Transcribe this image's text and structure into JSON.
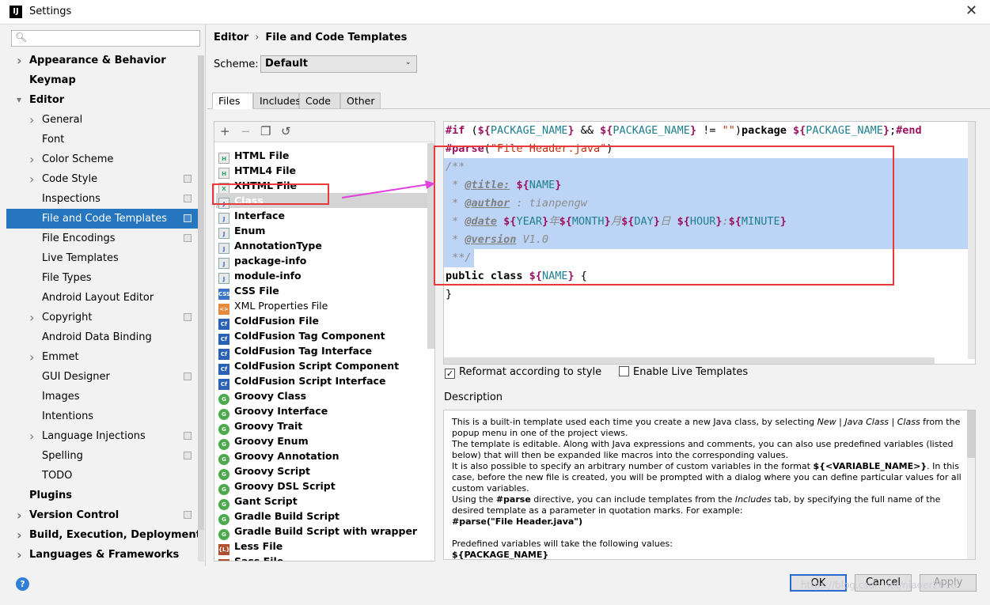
{
  "window": {
    "title": "Settings",
    "close_icon": "close-icon"
  },
  "search": {
    "placeholder": "Q↓"
  },
  "sidebar": {
    "items": [
      {
        "label": "Appearance & Behavior",
        "bold": true,
        "arrow": true,
        "indent": 0
      },
      {
        "label": "Keymap",
        "bold": true,
        "indent": 0
      },
      {
        "label": "Editor",
        "bold": true,
        "expanded": true,
        "indent": 0
      },
      {
        "label": "General",
        "arrow": true,
        "indent": 1
      },
      {
        "label": "Font",
        "indent": 1
      },
      {
        "label": "Color Scheme",
        "arrow": true,
        "indent": 1
      },
      {
        "label": "Code Style",
        "arrow": true,
        "indent": 1,
        "cfg": true
      },
      {
        "label": "Inspections",
        "indent": 1,
        "cfg": true
      },
      {
        "label": "File and Code Templates",
        "indent": 1,
        "cfg": true,
        "selected": true
      },
      {
        "label": "File Encodings",
        "indent": 1,
        "cfg": true
      },
      {
        "label": "Live Templates",
        "indent": 1
      },
      {
        "label": "File Types",
        "indent": 1
      },
      {
        "label": "Android Layout Editor",
        "indent": 1
      },
      {
        "label": "Copyright",
        "arrow": true,
        "indent": 1,
        "cfg": true
      },
      {
        "label": "Android Data Binding",
        "indent": 1
      },
      {
        "label": "Emmet",
        "arrow": true,
        "indent": 1
      },
      {
        "label": "GUI Designer",
        "indent": 1,
        "cfg": true
      },
      {
        "label": "Images",
        "indent": 1
      },
      {
        "label": "Intentions",
        "indent": 1
      },
      {
        "label": "Language Injections",
        "arrow": true,
        "indent": 1,
        "cfg": true
      },
      {
        "label": "Spelling",
        "indent": 1,
        "cfg": true
      },
      {
        "label": "TODO",
        "indent": 1
      },
      {
        "label": "Plugins",
        "bold": true,
        "indent": 0
      },
      {
        "label": "Version Control",
        "bold": true,
        "arrow": true,
        "indent": 0,
        "cfg": true
      },
      {
        "label": "Build, Execution, Deployment",
        "bold": true,
        "arrow": true,
        "indent": 0
      },
      {
        "label": "Languages & Frameworks",
        "bold": true,
        "arrow": true,
        "indent": 0
      }
    ]
  },
  "breadcrumb": [
    "Editor",
    "File and Code Templates"
  ],
  "breadcrumb_sep": "›",
  "scheme": {
    "label": "Scheme:",
    "value": "Default"
  },
  "tabs": [
    "Files",
    "Includes",
    "Code",
    "Other"
  ],
  "toolbar": {
    "add": "+",
    "remove": "−",
    "copy": "❐",
    "reset": "↺"
  },
  "templates": [
    {
      "label": "HTML File",
      "icon": "file",
      "t": "H"
    },
    {
      "label": "HTML4 File",
      "icon": "file",
      "t": "H"
    },
    {
      "label": "XHTML File",
      "icon": "file",
      "t": "X"
    },
    {
      "label": "Class",
      "icon": "java",
      "t": "J",
      "selected": true
    },
    {
      "label": "Interface",
      "icon": "java",
      "t": "J"
    },
    {
      "label": "Enum",
      "icon": "java",
      "t": "J"
    },
    {
      "label": "AnnotationType",
      "icon": "java",
      "t": "J"
    },
    {
      "label": "package-info",
      "icon": "java",
      "t": "J"
    },
    {
      "label": "module-info",
      "icon": "java",
      "t": "J"
    },
    {
      "label": "CSS File",
      "icon": "css",
      "t": "CSS"
    },
    {
      "label": "XML Properties File",
      "icon": "xml",
      "t": "<>",
      "normal": true
    },
    {
      "label": "ColdFusion File",
      "icon": "cf",
      "t": "Cf"
    },
    {
      "label": "ColdFusion Tag Component",
      "icon": "cf",
      "t": "Cf"
    },
    {
      "label": "ColdFusion Tag Interface",
      "icon": "cf",
      "t": "Cf"
    },
    {
      "label": "ColdFusion Script Component",
      "icon": "cf",
      "t": "Cf"
    },
    {
      "label": "ColdFusion Script Interface",
      "icon": "cf",
      "t": "Cf"
    },
    {
      "label": "Groovy Class",
      "icon": "gr",
      "t": "G"
    },
    {
      "label": "Groovy Interface",
      "icon": "gr",
      "t": "G"
    },
    {
      "label": "Groovy Trait",
      "icon": "gr",
      "t": "G"
    },
    {
      "label": "Groovy Enum",
      "icon": "gr",
      "t": "G"
    },
    {
      "label": "Groovy Annotation",
      "icon": "gr",
      "t": "G"
    },
    {
      "label": "Groovy Script",
      "icon": "gr",
      "t": "G"
    },
    {
      "label": "Groovy DSL Script",
      "icon": "gr",
      "t": "G"
    },
    {
      "label": "Gant Script",
      "icon": "gr",
      "t": "G"
    },
    {
      "label": "Gradle Build Script",
      "icon": "gr",
      "t": "G"
    },
    {
      "label": "Gradle Build Script with wrapper",
      "icon": "gr",
      "t": "G"
    },
    {
      "label": "Less File",
      "icon": "less",
      "t": "{L}"
    },
    {
      "label": "Sass File",
      "icon": "less",
      "t": "SASS"
    }
  ],
  "code_lines": [
    [
      [
        "dir",
        "#if"
      ],
      [
        "",
        " ("
      ],
      [
        "dl",
        "${"
      ],
      [
        "var",
        "PACKAGE_NAME"
      ],
      [
        "dl",
        "}"
      ],
      [
        "",
        " && "
      ],
      [
        "dl",
        "${"
      ],
      [
        "var",
        "PACKAGE_NAME"
      ],
      [
        "dl",
        "}"
      ],
      [
        "",
        " != "
      ],
      [
        "str",
        "\"\""
      ],
      [
        "",
        ")"
      ],
      [
        "kw",
        "package "
      ],
      [
        "dl",
        "${"
      ],
      [
        "var",
        "PACKAGE_NAME"
      ],
      [
        "dl",
        "}"
      ],
      [
        "",
        ";"
      ],
      [
        "dir",
        "#end"
      ]
    ],
    [
      [
        "dir",
        "#parse"
      ],
      [
        "",
        "("
      ],
      [
        "str",
        "\"File Header.java\""
      ],
      [
        "",
        ")"
      ]
    ],
    [
      [
        "cm",
        "/**"
      ]
    ],
    [
      [
        "cm",
        " * "
      ],
      [
        "tag",
        "@title:"
      ],
      [
        "",
        " "
      ],
      [
        "dl",
        "${"
      ],
      [
        "var",
        "NAME"
      ],
      [
        "dl",
        "}"
      ]
    ],
    [
      [
        "cm",
        " * "
      ],
      [
        "tag",
        "@author"
      ],
      [
        "cm",
        " : tianpengw"
      ]
    ],
    [
      [
        "cm",
        " * "
      ],
      [
        "tag",
        "@date"
      ],
      [
        "",
        " "
      ],
      [
        "dl",
        "${"
      ],
      [
        "var",
        "YEAR"
      ],
      [
        "dl",
        "}"
      ],
      [
        "cm",
        "年"
      ],
      [
        "dl",
        "${"
      ],
      [
        "var",
        "MONTH"
      ],
      [
        "dl",
        "}"
      ],
      [
        "cm",
        "月"
      ],
      [
        "dl",
        "${"
      ],
      [
        "var",
        "DAY"
      ],
      [
        "dl",
        "}"
      ],
      [
        "cm",
        "日 "
      ],
      [
        "dl",
        "${"
      ],
      [
        "var",
        "HOUR"
      ],
      [
        "dl",
        "}"
      ],
      [
        "cm",
        ":"
      ],
      [
        "dl",
        "${"
      ],
      [
        "var",
        "MINUTE"
      ],
      [
        "dl",
        "}"
      ]
    ],
    [
      [
        "cm",
        " * "
      ],
      [
        "tag",
        "@version"
      ],
      [
        "cm",
        " V1.0"
      ]
    ],
    [
      [
        "cm",
        " **/"
      ]
    ],
    [
      [
        "kw",
        "public class "
      ],
      [
        "dl",
        "${"
      ],
      [
        "var",
        "NAME"
      ],
      [
        "dl",
        "}"
      ],
      [
        "",
        " {"
      ]
    ],
    [
      [
        "",
        "}"
      ]
    ]
  ],
  "options": {
    "reformat": {
      "label": "Reformat according to style",
      "checked": true
    },
    "live": {
      "label": "Enable Live Templates",
      "checked": false
    }
  },
  "description": {
    "label": "Description",
    "paragraphs": [
      "This is a built-in template used each time you create a new Java class, by selecting <i>New</i> | <i>Java Class</i> | <i>Class</i> from the popup menu in one of the project views.",
      "The template is editable. Along with Java expressions and comments, you can also use predefined variables (listed below) that will then be expanded like macros into the corresponding values.",
      "It is also possible to specify an arbitrary number of custom variables in the format <b>${&lt;VARIABLE_NAME&gt;}</b>. In this case, before the new file is created, you will be prompted with a dialog where you can define particular values for all custom variables.",
      "Using the <b>#parse</b> directive, you can include templates from the <i>Includes</i> tab, by specifying the full name of the desired template as a parameter in quotation marks. For example:",
      "<b>#parse(\"File Header.java\")</b>",
      "&nbsp;",
      "Predefined variables will take the following values:",
      "<b>${PACKAGE_NAME}</b>"
    ]
  },
  "buttons": {
    "ok": "OK",
    "cancel": "Cancel",
    "apply": "Apply",
    "help": "?"
  },
  "watermark": "https://blog.csdn.net/niaoer2010",
  "colors": {
    "selection": "#2675bf",
    "annotation": "#e83a3a",
    "arrow": "#e040e0"
  }
}
